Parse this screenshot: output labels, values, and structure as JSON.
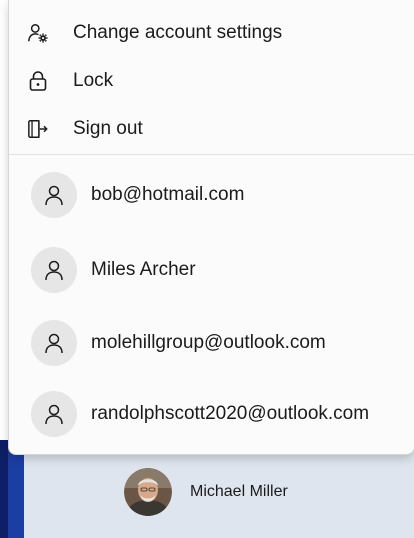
{
  "menu": {
    "items": [
      {
        "label": "Change account settings",
        "icon": "account-settings-icon"
      },
      {
        "label": "Lock",
        "icon": "lock-icon"
      },
      {
        "label": "Sign out",
        "icon": "sign-out-icon"
      }
    ]
  },
  "accounts": [
    {
      "label": "bob@hotmail.com",
      "icon": "person-icon"
    },
    {
      "label": "Miles Archer",
      "icon": "person-icon"
    },
    {
      "label": "molehillgroup@outlook.com",
      "icon": "person-icon"
    },
    {
      "label": "randolphscott2020@outlook.com",
      "icon": "person-icon"
    }
  ],
  "current_user": {
    "name": "Michael Miller",
    "avatar_icon": "user-photo-avatar"
  },
  "colors": {
    "panel": "#fbfbfb",
    "avatar_bg": "#e6e6e6",
    "taskbar": "#dfe5ee",
    "accent": "#1c3ea3"
  }
}
